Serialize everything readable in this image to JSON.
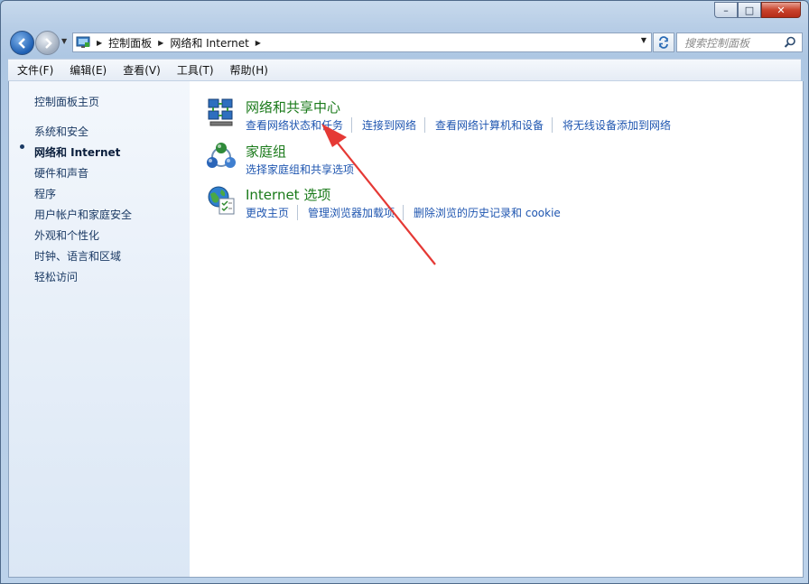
{
  "window": {
    "caption_buttons": {
      "minimize": "–",
      "maximize": "□",
      "close": "✕"
    }
  },
  "address_bar": {
    "crumbs": [
      "控制面板",
      "网络和 Internet"
    ],
    "search_placeholder": "搜索控制面板"
  },
  "menu": [
    "文件(F)",
    "编辑(E)",
    "查看(V)",
    "工具(T)",
    "帮助(H)"
  ],
  "sidebar": {
    "home": "控制面板主页",
    "items": [
      "系统和安全",
      "网络和 Internet",
      "硬件和声音",
      "程序",
      "用户帐户和家庭安全",
      "外观和个性化",
      "时钟、语言和区域",
      "轻松访问"
    ],
    "current_index": 1
  },
  "categories": [
    {
      "title": "网络和共享中心",
      "icon": "network-sharing-center-icon",
      "links": [
        "查看网络状态和任务",
        "连接到网络",
        "查看网络计算机和设备",
        "将无线设备添加到网络"
      ]
    },
    {
      "title": "家庭组",
      "icon": "homegroup-icon",
      "links": [
        "选择家庭组和共享选项"
      ]
    },
    {
      "title": "Internet 选项",
      "icon": "internet-options-icon",
      "links": [
        "更改主页",
        "管理浏览器加载项",
        "删除浏览的历史记录和 cookie"
      ]
    }
  ],
  "colors": {
    "category_title": "#1a7a1a",
    "link": "#1f56b0",
    "annotation_arrow": "#e53935"
  }
}
